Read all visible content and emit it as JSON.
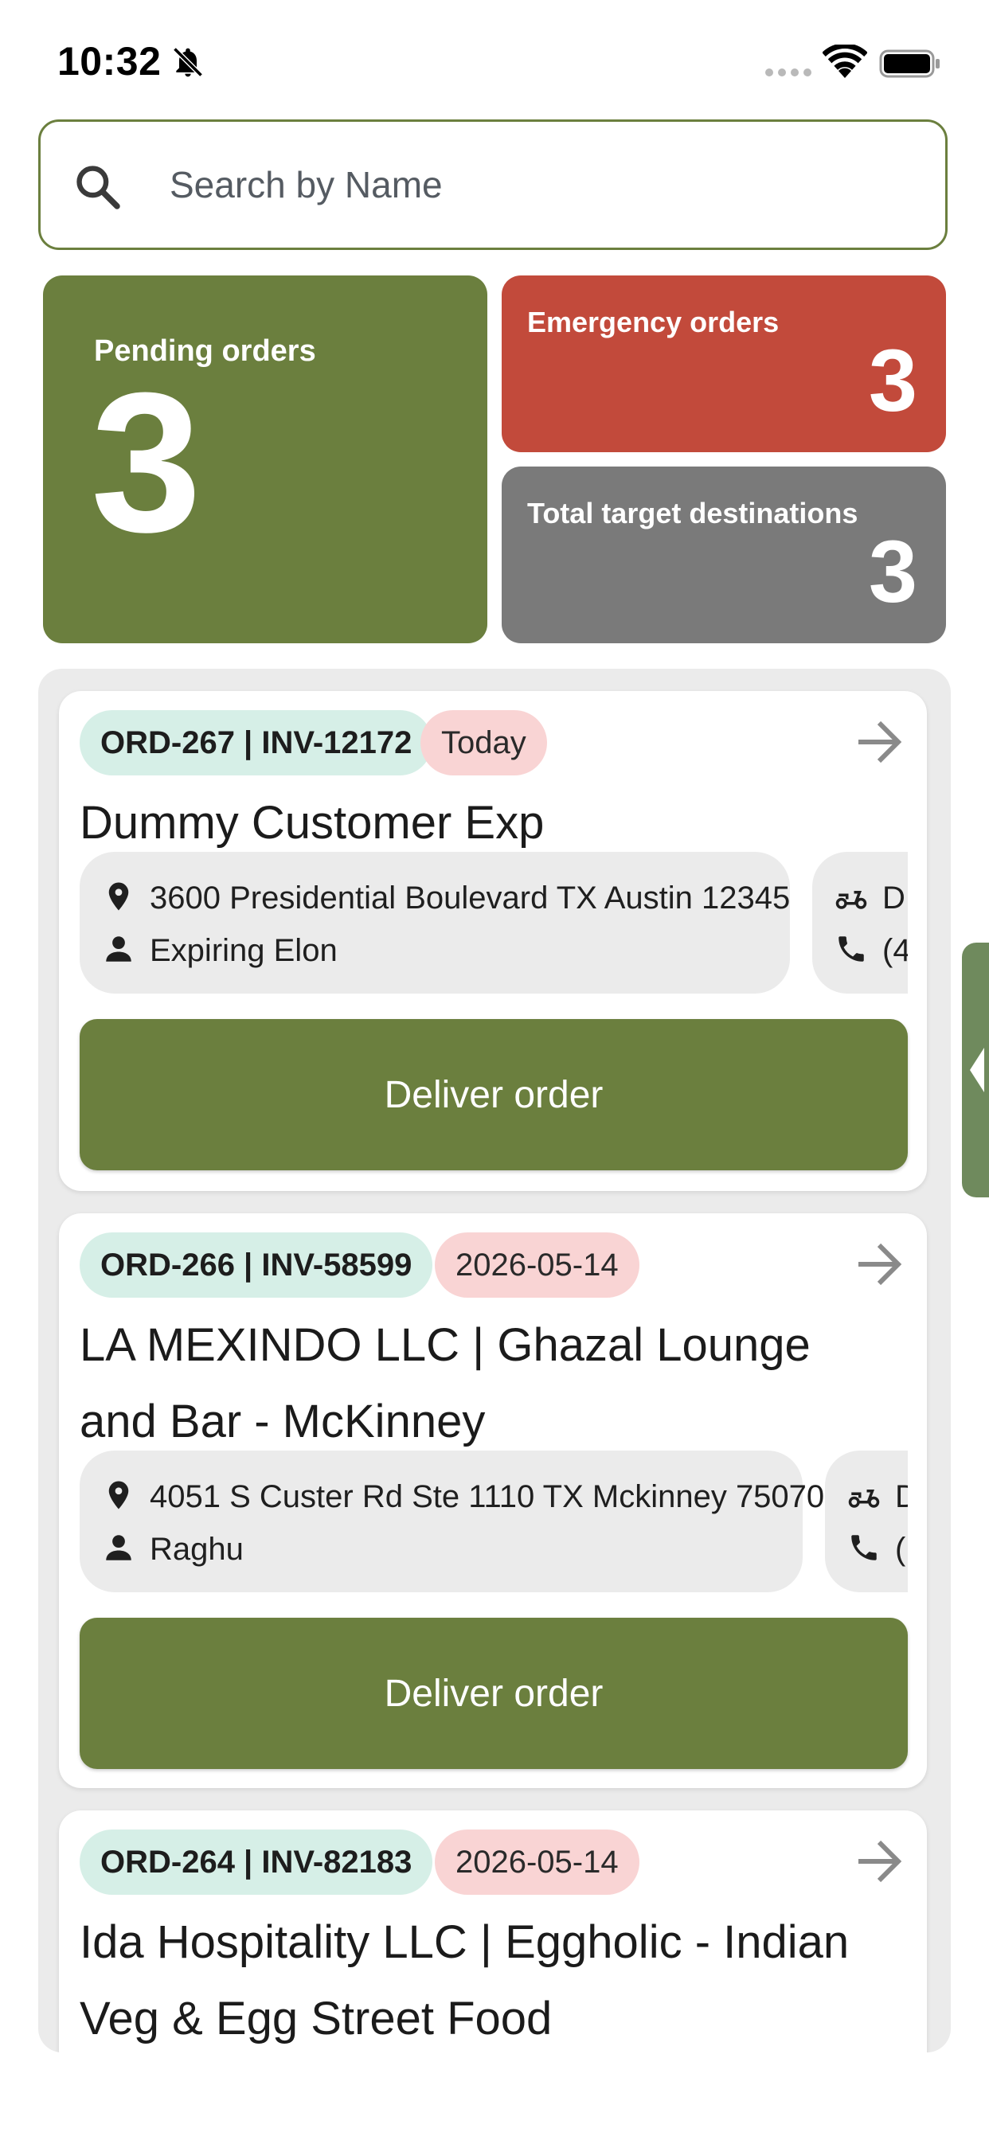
{
  "status_bar": {
    "time": "10:32"
  },
  "search": {
    "placeholder": "Search by Name",
    "value": ""
  },
  "stats": {
    "pending": {
      "label": "Pending orders",
      "count": "3",
      "color": "#6b7f3e"
    },
    "emergency": {
      "label": "Emergency orders",
      "count": "3",
      "color": "#c24a3b"
    },
    "total_destinations": {
      "label": "Total target destinations",
      "count": "3",
      "color": "#7a7a7a"
    }
  },
  "orders": [
    {
      "id": "ORD-267 | INV-12172",
      "date": "Today",
      "customer": "Dummy Customer Exp",
      "address": "3600 Presidential Boulevard TX Austin 12345",
      "contact": "Expiring Elon",
      "driver_partial": "D",
      "phone_partial": "(4",
      "action": "Deliver order"
    },
    {
      "id": "ORD-266 | INV-58599",
      "date": "2026-05-14",
      "customer": "LA MEXINDO LLC | Ghazal Lounge and Bar - McKinney",
      "address": "4051 S Custer Rd Ste 1110 TX Mckinney 75070",
      "contact": "Raghu",
      "driver_partial": "D",
      "phone_partial": "(",
      "action": "Deliver order"
    },
    {
      "id": "ORD-264 | INV-82183",
      "date": "2026-05-14",
      "customer": "Ida Hospitality LLC | Eggholic - Indian Veg & Egg Street Food"
    }
  ],
  "colors": {
    "accent": "#6b7f3e",
    "danger": "#c24a3b",
    "neutral": "#7a7a7a",
    "id_badge": "#d6efe7",
    "date_badge": "#f9d4d4",
    "drawer_handle": "#6f8a5d"
  },
  "icons": {
    "search": "search-icon",
    "arrow": "arrow-right-icon",
    "location": "location-pin-icon",
    "person": "person-icon",
    "scooter": "scooter-icon",
    "phone": "phone-icon",
    "bell_muted": "bell-muted-icon"
  }
}
